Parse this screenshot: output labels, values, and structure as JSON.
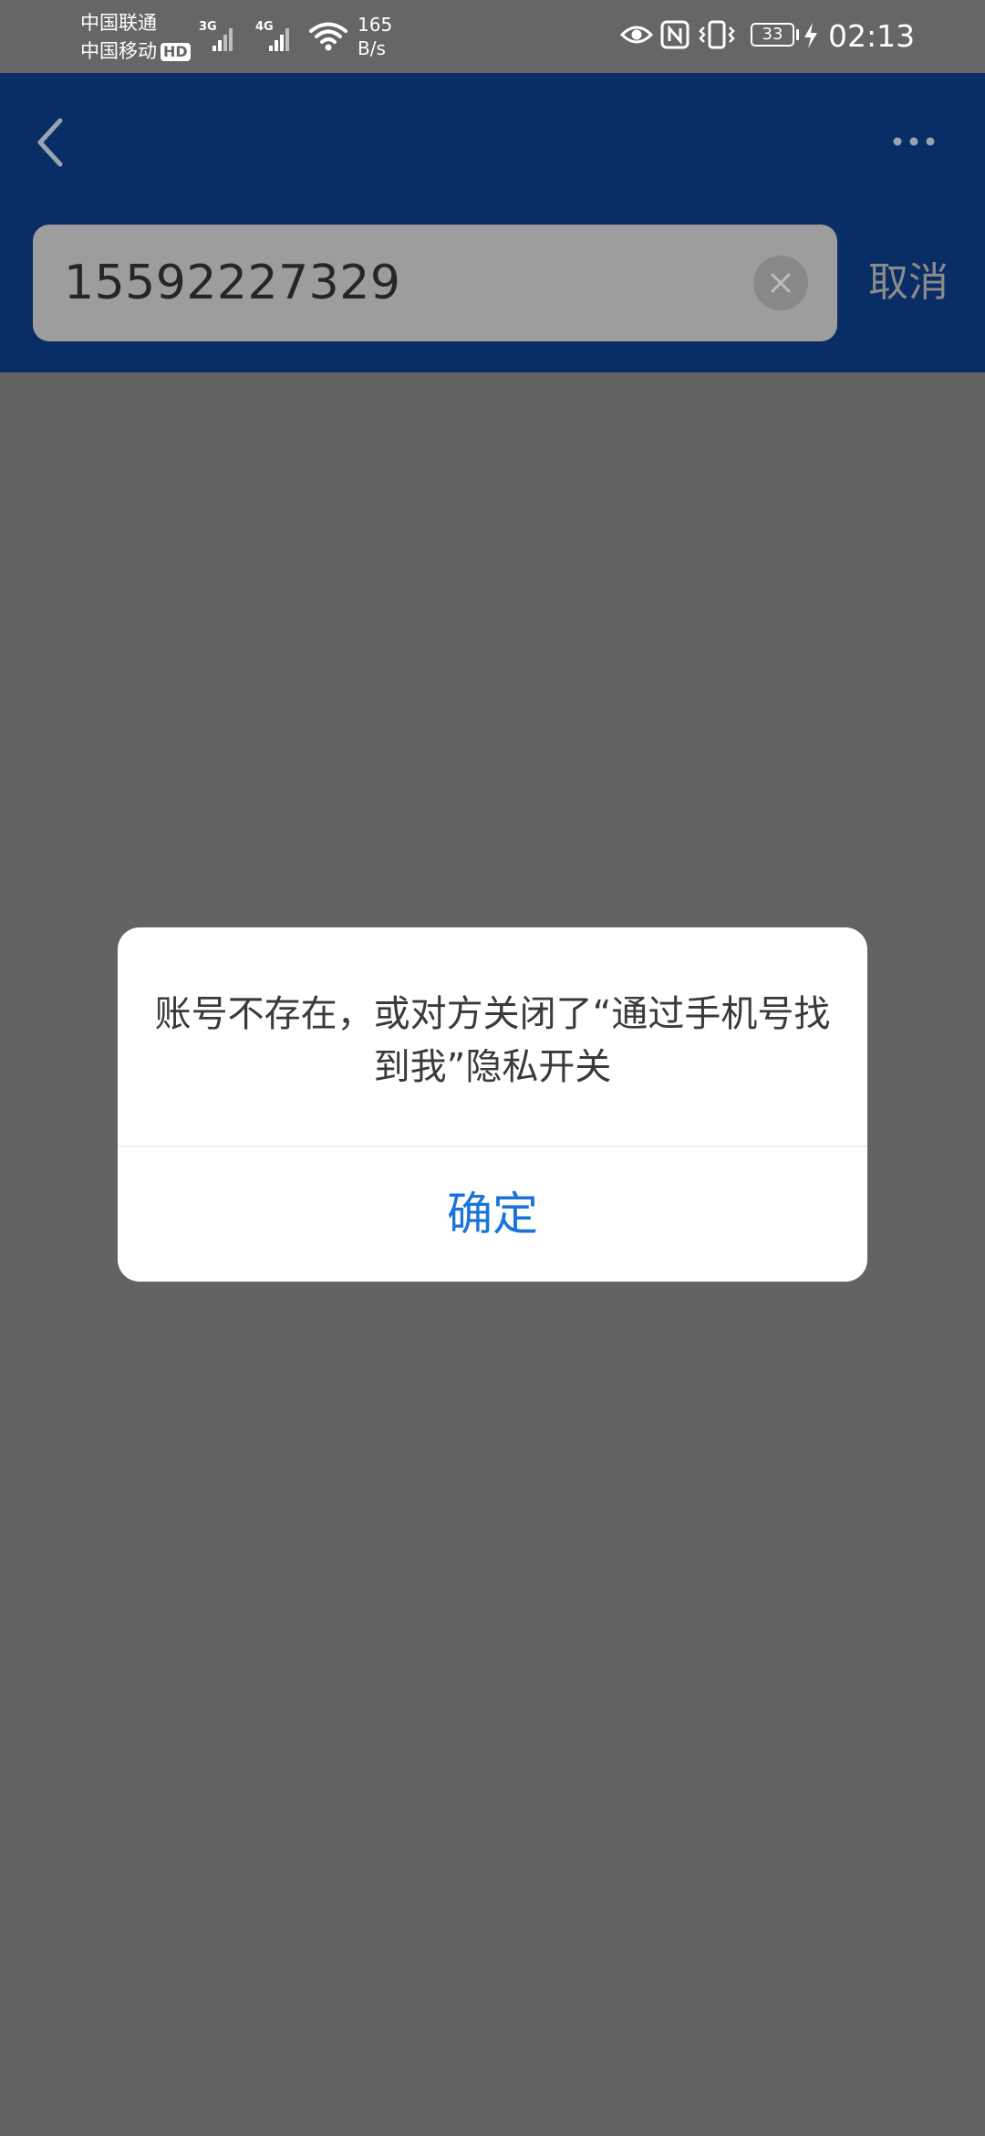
{
  "status_bar": {
    "carrier_1": "中国联通",
    "carrier_2": "中国移动",
    "hd_badge": "HD",
    "signal_1_type": "3G",
    "signal_2_type": "4G",
    "net_speed_value": "165",
    "net_speed_unit": "B/s",
    "battery_level": "33",
    "time": "02:13"
  },
  "header": {
    "back_icon": "chevron-left-icon",
    "more_icon": "more-dots-icon",
    "background_color": "#082e65"
  },
  "search": {
    "value": "15592227329",
    "clear_icon": "clear-circle-icon",
    "cancel_label": "取消"
  },
  "dialog": {
    "message": "账号不存在，或对方关闭了“通过手机号找到我”隐私开关",
    "confirm_label": "确定",
    "confirm_color": "#1a73d9"
  },
  "colors": {
    "overlay": "#636363",
    "status_bar": "#666666"
  }
}
